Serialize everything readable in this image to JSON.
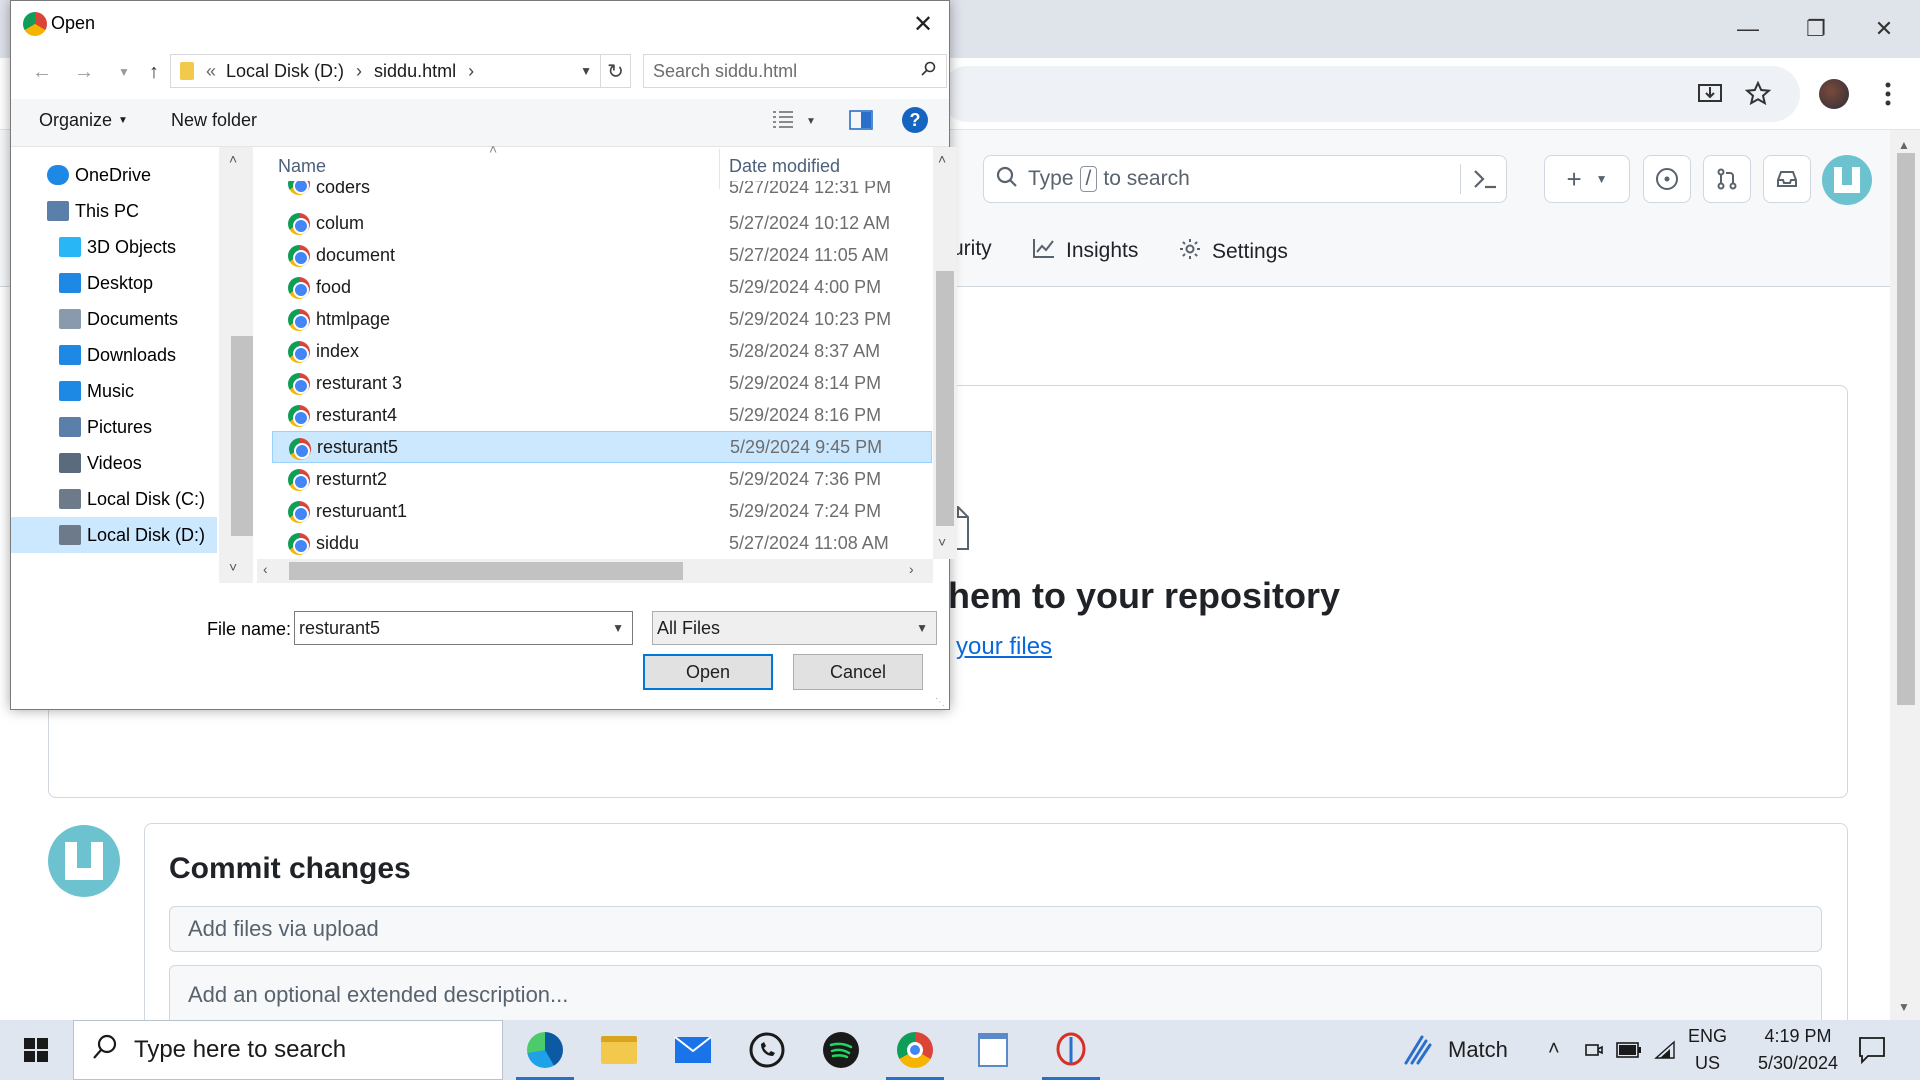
{
  "browser": {
    "search_placeholder_prefix": "Type",
    "search_key": "/",
    "search_placeholder_suffix": "to search"
  },
  "github": {
    "nav": {
      "security_partial": "urity",
      "insights": "Insights",
      "settings": "Settings"
    },
    "upload": {
      "heading_partial": "hem to your repository",
      "link_partial": "your files"
    },
    "commit": {
      "title": "Commit changes",
      "summary_placeholder": "Add files via upload",
      "description_placeholder": "Add an optional extended description..."
    }
  },
  "dialog": {
    "title": "Open",
    "breadcrumb": {
      "chevron": "«",
      "segments": [
        "Local Disk (D:)",
        "siddu.html"
      ]
    },
    "search_placeholder": "Search siddu.html",
    "toolbar": {
      "organize": "Organize",
      "new_folder": "New folder"
    },
    "nav_pane": [
      {
        "label": "OneDrive",
        "icon": "cloud-icon",
        "indent": 1,
        "selected": false
      },
      {
        "label": "This PC",
        "icon": "computer-icon",
        "indent": 1,
        "selected": false
      },
      {
        "label": "3D Objects",
        "icon": "cube-icon",
        "indent": 2,
        "selected": false
      },
      {
        "label": "Desktop",
        "icon": "desktop-icon",
        "indent": 2,
        "selected": false
      },
      {
        "label": "Documents",
        "icon": "document-icon",
        "indent": 2,
        "selected": false
      },
      {
        "label": "Downloads",
        "icon": "download-arrow-icon",
        "indent": 2,
        "selected": false
      },
      {
        "label": "Music",
        "icon": "music-note-icon",
        "indent": 2,
        "selected": false
      },
      {
        "label": "Pictures",
        "icon": "pictures-icon",
        "indent": 2,
        "selected": false
      },
      {
        "label": "Videos",
        "icon": "film-icon",
        "indent": 2,
        "selected": false
      },
      {
        "label": "Local Disk (C:)",
        "icon": "drive-icon",
        "indent": 2,
        "selected": false
      },
      {
        "label": "Local Disk (D:)",
        "icon": "drive-icon",
        "indent": 2,
        "selected": true
      }
    ],
    "columns": {
      "name": "Name",
      "date": "Date modified"
    },
    "files": [
      {
        "name": "coders",
        "date": "5/27/2024 12:31 PM",
        "selected": false
      },
      {
        "name": "colum",
        "date": "5/27/2024 10:12 AM",
        "selected": false
      },
      {
        "name": "document",
        "date": "5/27/2024 11:05 AM",
        "selected": false
      },
      {
        "name": "food",
        "date": "5/29/2024 4:00 PM",
        "selected": false
      },
      {
        "name": "htmlpage",
        "date": "5/29/2024 10:23 PM",
        "selected": false
      },
      {
        "name": "index",
        "date": "5/28/2024 8:37 AM",
        "selected": false
      },
      {
        "name": "resturant 3",
        "date": "5/29/2024 8:14 PM",
        "selected": false
      },
      {
        "name": "resturant4",
        "date": "5/29/2024 8:16 PM",
        "selected": false
      },
      {
        "name": "resturant5",
        "date": "5/29/2024 9:45 PM",
        "selected": true
      },
      {
        "name": "resturnt2",
        "date": "5/29/2024 7:36 PM",
        "selected": false
      },
      {
        "name": "resturuant1",
        "date": "5/29/2024 7:24 PM",
        "selected": false
      },
      {
        "name": "siddu",
        "date": "5/27/2024 11:08 AM",
        "selected": false
      }
    ],
    "file_name_label": "File name:",
    "file_name_value": "resturant5",
    "file_type": "All Files",
    "open_button": "Open",
    "cancel_button": "Cancel"
  },
  "taskbar": {
    "search_placeholder": "Type here to search",
    "apps": [
      "edge-icon",
      "file-explorer-icon",
      "mail-icon",
      "whatsapp-icon",
      "spotify-icon",
      "chrome-icon",
      "notepad-icon",
      "paint-icon"
    ],
    "widget_label": "Match",
    "language": "ENG",
    "region": "US",
    "time": "4:19 PM",
    "date": "5/30/2024"
  },
  "colors": {
    "selection": "#cce8ff",
    "accent": "#0078d7",
    "github_link": "#0969da"
  }
}
